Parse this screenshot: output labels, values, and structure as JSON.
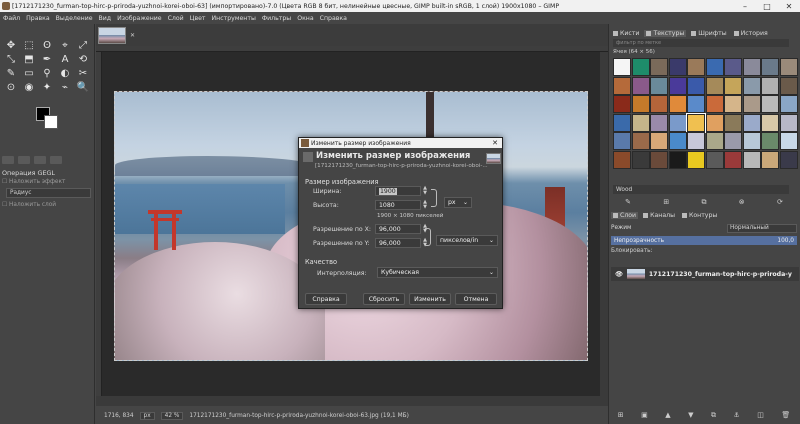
{
  "window": {
    "title": "[1712171230_furman-top-hirc-p-priroda-yuzhnoi-korei-oboi-63] (импортировано)-7.0 (Цвета RGB 8 бит, нелинейные цвесные, GIMP built-in sRGB, 1 слой) 1900x1080 – GIMP",
    "minimize": "–",
    "maximize": "□",
    "close": "✕"
  },
  "menu": [
    "Файл",
    "Правка",
    "Выделение",
    "Вид",
    "Изображение",
    "Слой",
    "Цвет",
    "Инструменты",
    "Фильтры",
    "Окна",
    "Справка"
  ],
  "toolbox": {
    "tools": [
      "✥",
      "⬚",
      "ʘ",
      "⌖",
      "⤢",
      "⤡",
      "⬒",
      "✒",
      "A",
      "⟲",
      "✎",
      "▭",
      "⚲",
      "◐",
      "✂",
      "⊙",
      "◉",
      "✦",
      "⌁",
      "🔍"
    ],
    "tool_names": [
      "move-tool-icon",
      "rect-select-icon",
      "lasso-icon",
      "fuzzy-select-icon",
      "crop-icon",
      "transform-icon",
      "cage-icon",
      "paths-icon",
      "text-icon",
      "warp-icon",
      "paintbrush-icon",
      "bucket-fill-icon",
      "clone-icon",
      "dodge-icon",
      "smudge-icon",
      "measure-icon",
      "eyedropper-icon",
      "heal-icon",
      "ink-icon",
      "zoom-icon"
    ],
    "gegl_title": "Операция GEGL",
    "option1": "Наложить эффект",
    "radius_label": "Радиус",
    "option2": "Наложить слой"
  },
  "image_tab": {
    "close": "✕"
  },
  "status": {
    "coords": "1716, 834",
    "unit": "px",
    "zoom": "42 %",
    "file": "1712171230_furman-top-hirc-p-priroda-yuzhnoi-korei-oboi-63.jpg (19,1 МБ)"
  },
  "right_dock": {
    "tabs": [
      {
        "label": "Кисти",
        "active": false
      },
      {
        "label": "Текстуры",
        "active": true
      },
      {
        "label": "Шрифты",
        "active": false
      },
      {
        "label": "История",
        "active": false
      }
    ],
    "filter_placeholder": "фильтр по метке",
    "tex_size": "Ячея (64 × 56)",
    "texture_colors": [
      "#f5f5f5",
      "#1e8c6a",
      "#7a6a5a",
      "#3a3a6a",
      "#9a7a5a",
      "#3a6ab0",
      "#5a5a8a",
      "#8a8a9a",
      "#6a7a8a",
      "#9a8a7a",
      "#b56a3a",
      "#8a5a8a",
      "#6a8a9a",
      "#4a3a9a",
      "#3a5aaa",
      "#a58a5a",
      "#c5a55a",
      "#8a9aaa",
      "#b0b0b0",
      "#6a5a4a",
      "#8a2a1a",
      "#c57a2a",
      "#b5653a",
      "#e08a3a",
      "#5a8aca",
      "#ca6a3a",
      "#d5b58a",
      "#aa9a8a",
      "#bababa",
      "#8aa6c6",
      "#3a6aaa",
      "#c5b58a",
      "#9a8aaa",
      "#7a9aca",
      "#f0c050",
      "#e0a060",
      "#8a7a5a",
      "#9aaaca",
      "#d8c8a8",
      "#b8b8c8",
      "#5a7aaa",
      "#9a6a4a",
      "#d8a878",
      "#4a8aca",
      "#c8c8d8",
      "#aaa88a",
      "#9a9aaa",
      "#b8c8d8",
      "#6a8a6a",
      "#c8d8e8",
      "#8a4a2a",
      "#3a3a3a",
      "#6a4a3a",
      "#1a1a1a",
      "#e8c820",
      "#5a5a5a",
      "#9a3a3a",
      "#b8b8b8",
      "#caa87a",
      "#3a3a4a"
    ],
    "selected_index": 34,
    "tex_name": "Wood",
    "layers_tabs": [
      {
        "label": "Слои",
        "active": true
      },
      {
        "label": "Каналы",
        "active": false
      },
      {
        "label": "Контуры",
        "active": false
      }
    ],
    "mode_label": "Режим",
    "mode_value": "Нормальный",
    "opacity_label": "Непрозрачность",
    "opacity_value": "100,0",
    "lock_label": "Блокировать:",
    "layer_name": "1712171230_furman-top-hirc-p-priroda-y"
  },
  "dialog": {
    "title": "Изменить размер изображения",
    "close": "✕",
    "heading": "Изменить размер изображения",
    "subtitle": "[1712171230_furman-top-hirc-p-priroda-yuzhnoi-korei-oboi-...",
    "section_size": "Размер изображения",
    "width_label": "Ширина:",
    "width_value": "1900",
    "height_label": "Высота:",
    "height_value": "1080",
    "unit_px": "px",
    "size_info": "1900 × 1080 пикселей",
    "xres_label": "Разрешение по X:",
    "xres_value": "96,000",
    "yres_label": "Разрешение по Y:",
    "yres_value": "96,000",
    "res_unit": "пикселов/in",
    "section_quality": "Качество",
    "interp_label": "Интерполяция:",
    "interp_value": "Кубическая",
    "btn_help": "Справка",
    "btn_reset": "Сбросить",
    "btn_apply": "Изменить",
    "btn_cancel": "Отмена"
  }
}
